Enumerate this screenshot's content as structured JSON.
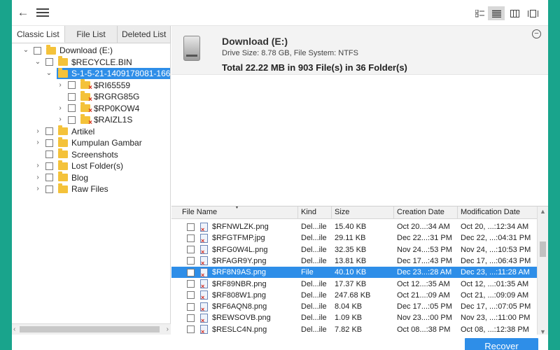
{
  "toolbar": {
    "back_icon": "arrow-left-icon",
    "menu_icon": "hamburger-menu-icon",
    "view_modes": [
      {
        "name": "thumbnail-view-icon",
        "active": false
      },
      {
        "name": "list-view-icon",
        "active": true
      },
      {
        "name": "column-view-icon",
        "active": false
      },
      {
        "name": "filmstrip-view-icon",
        "active": false
      }
    ]
  },
  "tabs": [
    {
      "label": "Classic List",
      "active": true
    },
    {
      "label": "File List",
      "active": false
    },
    {
      "label": "Deleted List",
      "active": false
    }
  ],
  "tree": [
    {
      "label": "Download (E:)",
      "expander": "⌄",
      "indent": 0,
      "deleted": false,
      "selected": false
    },
    {
      "label": "$RECYCLE.BIN",
      "expander": "⌄",
      "indent": 1,
      "deleted": false,
      "selected": false
    },
    {
      "label": "S-1-5-21-1409178081-166",
      "expander": "⌄",
      "indent": 2,
      "deleted": false,
      "selected": true
    },
    {
      "label": "$RI65559",
      "expander": "›",
      "indent": 3,
      "deleted": true,
      "selected": false
    },
    {
      "label": "$RGRG85G",
      "expander": "",
      "indent": 3,
      "deleted": true,
      "selected": false
    },
    {
      "label": "$RP0KOW4",
      "expander": "›",
      "indent": 3,
      "deleted": true,
      "selected": false
    },
    {
      "label": "$RAIZL1S",
      "expander": "›",
      "indent": 3,
      "deleted": true,
      "selected": false
    },
    {
      "label": "Artikel",
      "expander": "›",
      "indent": 1,
      "deleted": false,
      "selected": false
    },
    {
      "label": "Kumpulan Gambar",
      "expander": "›",
      "indent": 1,
      "deleted": false,
      "selected": false
    },
    {
      "label": "Screenshots",
      "expander": "",
      "indent": 1,
      "deleted": false,
      "selected": false
    },
    {
      "label": "Lost Folder(s)",
      "expander": "›",
      "indent": 1,
      "deleted": false,
      "selected": false
    },
    {
      "label": "Blog",
      "expander": "›",
      "indent": 1,
      "deleted": false,
      "selected": false
    },
    {
      "label": "Raw Files",
      "expander": "›",
      "indent": 1,
      "deleted": false,
      "selected": false
    }
  ],
  "drive": {
    "title": "Download (E:)",
    "subtitle": "Drive Size: 8.78 GB, File System: NTFS",
    "total": "Total 22.22 MB in 903 File(s) in 36 Folder(s)"
  },
  "table": {
    "columns": [
      "File Name",
      "Kind",
      "Size",
      "Creation Date",
      "Modification Date"
    ],
    "rows": [
      {
        "name": "$RFNWLZK.png",
        "kind": "Del...ile",
        "size": "15.40 KB",
        "created": "Oct 20...:34 AM",
        "modified": "Oct 20, ...:12:34 AM",
        "selected": false
      },
      {
        "name": "$RFGTFMP.jpg",
        "kind": "Del...ile",
        "size": "29.11 KB",
        "created": "Dec 22...:31 PM",
        "modified": "Dec 22, ...:04:31 PM",
        "selected": false
      },
      {
        "name": "$RFG0W4L.png",
        "kind": "Del...ile",
        "size": "32.35 KB",
        "created": "Nov 24...:53 PM",
        "modified": "Nov 24, ...:10:53 PM",
        "selected": false
      },
      {
        "name": "$RFAGR9Y.png",
        "kind": "Del...ile",
        "size": "13.81 KB",
        "created": "Dec 17...:43 PM",
        "modified": "Dec 17, ...:06:43 PM",
        "selected": false
      },
      {
        "name": "$RF8N9AS.png",
        "kind": "File",
        "size": "40.10 KB",
        "created": "Dec 23...:28 AM",
        "modified": "Dec 23, ...:11:28 AM",
        "selected": true
      },
      {
        "name": "$RF89NBR.png",
        "kind": "Del...ile",
        "size": "17.37 KB",
        "created": "Oct 12...:35 AM",
        "modified": "Oct 12, ...:01:35 AM",
        "selected": false
      },
      {
        "name": "$RF808W1.png",
        "kind": "Del...ile",
        "size": "247.68 KB",
        "created": "Oct 21...:09 AM",
        "modified": "Oct 21, ...:09:09 AM",
        "selected": false
      },
      {
        "name": "$RF6AQN8.png",
        "kind": "Del...ile",
        "size": "8.04 KB",
        "created": "Dec 17...:05 PM",
        "modified": "Dec 17, ...:07:05 PM",
        "selected": false
      },
      {
        "name": "$REWSOVB.png",
        "kind": "Del...ile",
        "size": "1.09 KB",
        "created": "Nov 23...:00 PM",
        "modified": "Nov 23, ...:11:00 PM",
        "selected": false
      },
      {
        "name": "$RESLC4N.png",
        "kind": "Del...ile",
        "size": "7.82 KB",
        "created": "Oct 08...:38 PM",
        "modified": "Oct 08, ...:12:38 PM",
        "selected": false
      }
    ]
  },
  "actions": {
    "recover_label": "Recover"
  },
  "colors": {
    "accent": "#2e8ee8",
    "background": "#19a48c",
    "folder": "#f4c23a",
    "deleted_mark": "#d52b1e"
  }
}
